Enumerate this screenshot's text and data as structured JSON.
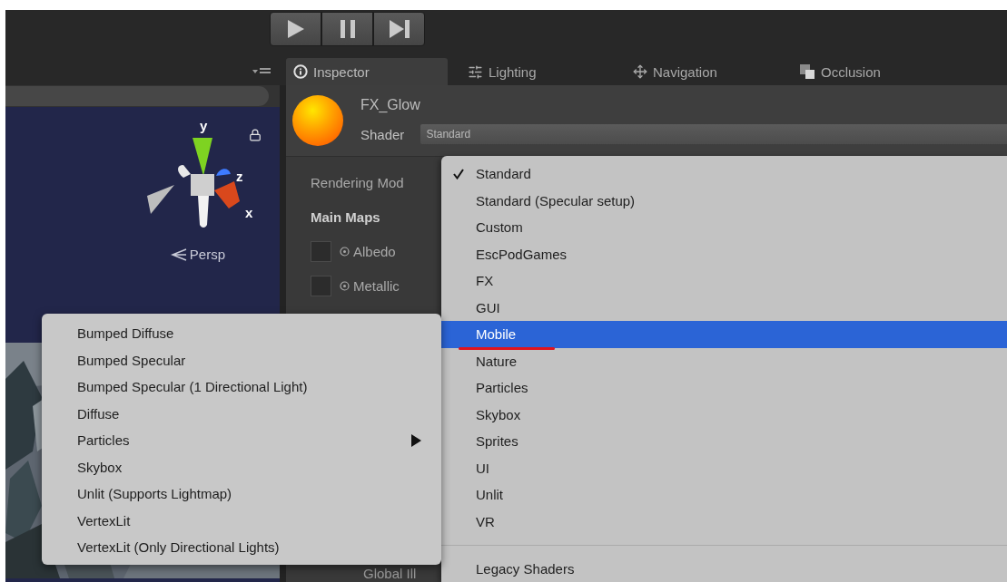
{
  "toolbar": {
    "buttons": [
      {
        "kind": "play"
      },
      {
        "kind": "pause"
      },
      {
        "kind": "step"
      }
    ]
  },
  "tabs": [
    {
      "label": "Inspector",
      "selected": true
    },
    {
      "label": "Lighting",
      "selected": false
    },
    {
      "label": "Navigation",
      "selected": false
    },
    {
      "label": "Occlusion",
      "selected": false
    }
  ],
  "scene": {
    "gizmo_axes": [
      "y",
      "z",
      "x"
    ],
    "view_label": "Persp",
    "background": {
      "kind": "picture"
    }
  },
  "inspector": {
    "material_name": "FX_Glow",
    "shader_label": "Shader",
    "shader_value": "Standard",
    "fields": [
      {
        "kind": "label",
        "label": "Rendering Mod"
      },
      {
        "kind": "heading",
        "label": "Main Maps"
      },
      {
        "kind": "texture",
        "label": "Albedo"
      },
      {
        "kind": "texture",
        "label": "Metallic"
      }
    ],
    "footer_label": "Global Ill"
  },
  "shader_menu": {
    "items": [
      {
        "label": "Standard",
        "checked": true,
        "selected": false,
        "underlined": false
      },
      {
        "label": "Standard (Specular setup)",
        "checked": false,
        "selected": false,
        "underlined": false
      },
      {
        "label": "Custom",
        "checked": false,
        "selected": false,
        "underlined": false
      },
      {
        "label": "EscPodGames",
        "checked": false,
        "selected": false,
        "underlined": false
      },
      {
        "label": "FX",
        "checked": false,
        "selected": false,
        "underlined": false
      },
      {
        "label": "GUI",
        "checked": false,
        "selected": false,
        "underlined": false
      },
      {
        "label": "Mobile",
        "checked": false,
        "selected": true,
        "underlined": true
      },
      {
        "label": "Nature",
        "checked": false,
        "selected": false,
        "underlined": false
      },
      {
        "label": "Particles",
        "checked": false,
        "selected": false,
        "underlined": false
      },
      {
        "label": "Skybox",
        "checked": false,
        "selected": false,
        "underlined": false
      },
      {
        "label": "Sprites",
        "checked": false,
        "selected": false,
        "underlined": false
      },
      {
        "label": "UI",
        "checked": false,
        "selected": false,
        "underlined": false
      },
      {
        "label": "Unlit",
        "checked": false,
        "selected": false,
        "underlined": false
      },
      {
        "label": "VR",
        "checked": false,
        "selected": false,
        "underlined": false
      }
    ],
    "footer_items": [
      {
        "label": "Legacy Shaders"
      }
    ]
  },
  "submenu": {
    "items": [
      {
        "label": "Bumped Diffuse",
        "has_submenu": false
      },
      {
        "label": "Bumped Specular",
        "has_submenu": false
      },
      {
        "label": "Bumped Specular (1 Directional Light)",
        "has_submenu": false
      },
      {
        "label": "Diffuse",
        "has_submenu": false
      },
      {
        "label": "Particles",
        "has_submenu": true
      },
      {
        "label": "Skybox",
        "has_submenu": false
      },
      {
        "label": "Unlit (Supports Lightmap)",
        "has_submenu": false
      },
      {
        "label": "VertexLit",
        "has_submenu": false
      },
      {
        "label": "VertexLit (Only Directional Lights)",
        "has_submenu": false
      }
    ]
  }
}
